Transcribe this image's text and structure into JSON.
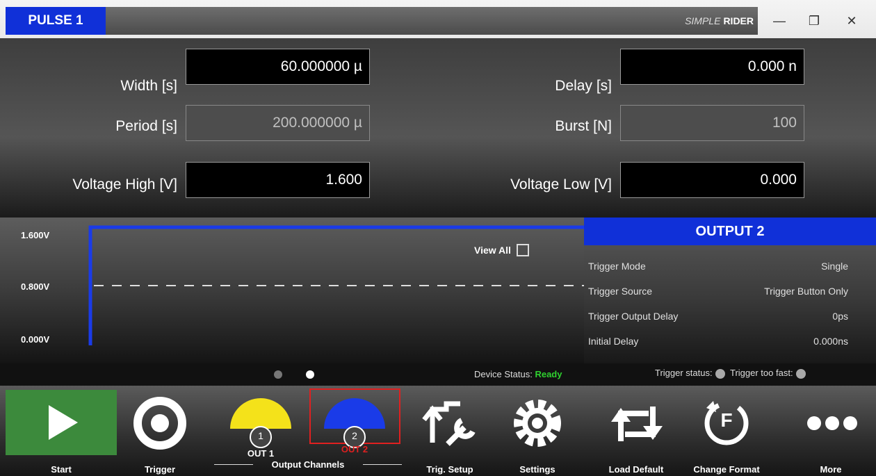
{
  "window": {
    "tab_title": "PULSE 1",
    "brand_left": "SIMPLE",
    "brand_right": "RIDER",
    "minimize_glyph": "—",
    "restore_glyph": "❐",
    "close_glyph": "✕"
  },
  "params": {
    "width_label": "Width [s]",
    "width_value": "60.000000 µ",
    "delay_label": "Delay [s]",
    "delay_value": "0.000 n",
    "period_label": "Period [s]",
    "period_value": "200.000000 µ",
    "burst_label": "Burst [N]",
    "burst_value": "100",
    "vhigh_label": "Voltage High [V]",
    "vhigh_value": "1.600",
    "vlow_label": "Voltage Low [V]",
    "vlow_value": "0.000"
  },
  "graph": {
    "y_max_label": "1.600V",
    "y_mid_label": "0.800V",
    "y_min_label": "0.000V",
    "view_all_label": "View All",
    "waveform_color": "#1a3be8"
  },
  "output": {
    "title": "OUTPUT 2",
    "rows": [
      {
        "key": "Trigger Mode",
        "value": "Single"
      },
      {
        "key": "Trigger Source",
        "value": "Trigger Button Only"
      },
      {
        "key": "Trigger Output Delay",
        "value": "0ps"
      },
      {
        "key": "Initial Delay",
        "value": "0.000ns"
      }
    ]
  },
  "status": {
    "device_label": "Device Status:",
    "device_value": "Ready",
    "trigger_status_label": "Trigger status:",
    "trigger_fast_label": "Trigger too fast:",
    "ready_color": "#2fd12f"
  },
  "toolbar": {
    "start": "Start",
    "trigger": "Trigger",
    "out1_number": "1",
    "out1_label": "OUT 1",
    "out2_number": "2",
    "out2_label": "OUT 2",
    "output_channels": "Output Channels",
    "trig_setup": "Trig. Setup",
    "settings": "Settings",
    "load_default": "Load Default",
    "change_format": "Change Format",
    "change_format_letter": "F",
    "more": "More"
  },
  "colors": {
    "accent_blue": "#1030d8",
    "out1_yellow": "#f4e21a",
    "out2_blue": "#1a3be8",
    "start_green": "#3c8a3c",
    "selected_red": "#e02020"
  }
}
